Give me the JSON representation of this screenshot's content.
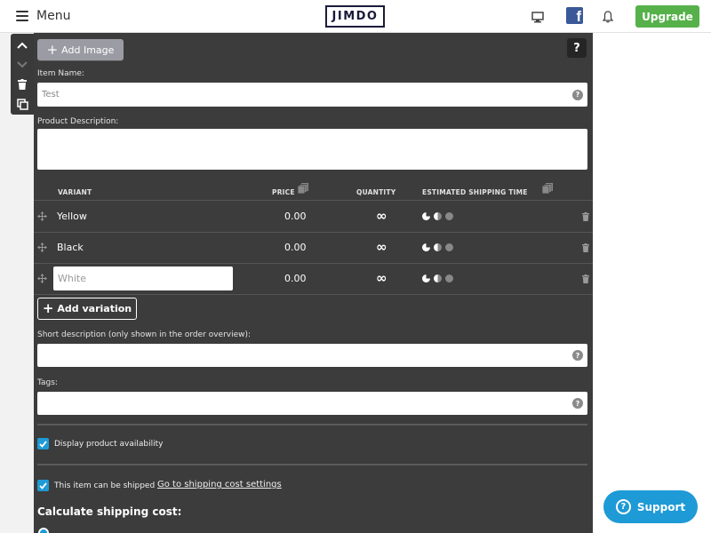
{
  "topbar": {
    "menu_label": "Menu",
    "logo_text": "JIMDO",
    "icons": [
      "hamburger-icon",
      "desktop-icon",
      "facebook-icon",
      "bell-icon"
    ],
    "upgrade_label": "Upgrade",
    "upgrade_color": "#56b14a"
  },
  "side_toolbar": {
    "icons": [
      "chevron-up-icon",
      "chevron-down-icon",
      "trash-icon",
      "duplicate-icon"
    ]
  },
  "editor": {
    "add_image_label": "Add Image",
    "help_label": "?",
    "item_name_label": "Item Name:",
    "item_name_value": "Test",
    "product_description_label": "Product Description:",
    "product_description_value": "",
    "variant_table": {
      "headers": {
        "variant": "VARIANT",
        "price": "PRICE",
        "quantity": "QUANTITY",
        "estimated_shipping_time": "ESTIMATED SHIPPING TIME"
      },
      "rows": [
        {
          "name": "Yellow",
          "price": "0.00",
          "quantity": "∞",
          "editing": false
        },
        {
          "name": "Black",
          "price": "0.00",
          "quantity": "∞",
          "editing": false
        },
        {
          "name": "White",
          "price": "0.00",
          "quantity": "∞",
          "editing": true
        }
      ]
    },
    "add_variation_label": "Add variation",
    "short_description_label": "Short description (only shown in the order overview):",
    "short_description_value": "",
    "tags_label": "Tags:",
    "tags_value": "",
    "display_availability": {
      "label": "Display product availability",
      "checked": true
    },
    "can_be_shipped": {
      "label": "This item can be shipped",
      "checked": true
    },
    "shipping_settings_link": "Go to shipping cost settings",
    "calculate_shipping_heading": "Calculate shipping cost:",
    "accent_color": "#1e9ad6"
  },
  "support": {
    "label": "Support",
    "color": "#1e9ad6"
  }
}
